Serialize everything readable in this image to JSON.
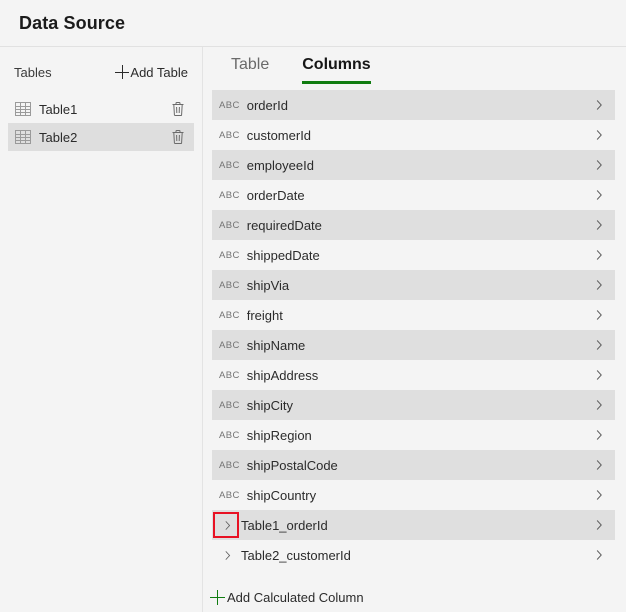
{
  "header": {
    "title": "Data Source"
  },
  "sidebar": {
    "tables_label": "Tables",
    "add_table_label": "Add Table",
    "add_table_icon": "plus-icon",
    "delete_icon": "trash-icon",
    "table_icon": "grid-table-icon",
    "selected_color": "#dedede",
    "items": [
      {
        "name": "Table1",
        "selected": false
      },
      {
        "name": "Table2",
        "selected": true
      }
    ]
  },
  "main": {
    "tabs": [
      {
        "label": "Table",
        "active": false
      },
      {
        "label": "Columns",
        "active": true
      }
    ],
    "active_tab_underline_color": "#107c10",
    "type_icon_label": "ABC",
    "chevron_icon": "chevron-right-icon",
    "columns": [
      {
        "name": "orderId",
        "type": "ABC",
        "lead_chevron": false,
        "shade": "a"
      },
      {
        "name": "customerId",
        "type": "ABC",
        "lead_chevron": false,
        "shade": "b"
      },
      {
        "name": "employeeId",
        "type": "ABC",
        "lead_chevron": false,
        "shade": "a"
      },
      {
        "name": "orderDate",
        "type": "ABC",
        "lead_chevron": false,
        "shade": "b"
      },
      {
        "name": "requiredDate",
        "type": "ABC",
        "lead_chevron": false,
        "shade": "a"
      },
      {
        "name": "shippedDate",
        "type": "ABC",
        "lead_chevron": false,
        "shade": "b"
      },
      {
        "name": "shipVia",
        "type": "ABC",
        "lead_chevron": false,
        "shade": "a"
      },
      {
        "name": "freight",
        "type": "ABC",
        "lead_chevron": false,
        "shade": "b"
      },
      {
        "name": "shipName",
        "type": "ABC",
        "lead_chevron": false,
        "shade": "a"
      },
      {
        "name": "shipAddress",
        "type": "ABC",
        "lead_chevron": false,
        "shade": "b"
      },
      {
        "name": "shipCity",
        "type": "ABC",
        "lead_chevron": false,
        "shade": "a"
      },
      {
        "name": "shipRegion",
        "type": "ABC",
        "lead_chevron": false,
        "shade": "b"
      },
      {
        "name": "shipPostalCode",
        "type": "ABC",
        "lead_chevron": false,
        "shade": "a"
      },
      {
        "name": "shipCountry",
        "type": "ABC",
        "lead_chevron": false,
        "shade": "b"
      },
      {
        "name": "Table1_orderId",
        "type": "",
        "lead_chevron": true,
        "shade": "a",
        "annotated": true
      },
      {
        "name": "Table2_customerId",
        "type": "",
        "lead_chevron": true,
        "shade": "b"
      }
    ],
    "add_calculated_column_label": "Add Calculated Column",
    "add_calculated_column_icon": "plus-icon"
  },
  "annotation": {
    "color": "#e81123",
    "target": "Table1_orderId expand chevron"
  }
}
